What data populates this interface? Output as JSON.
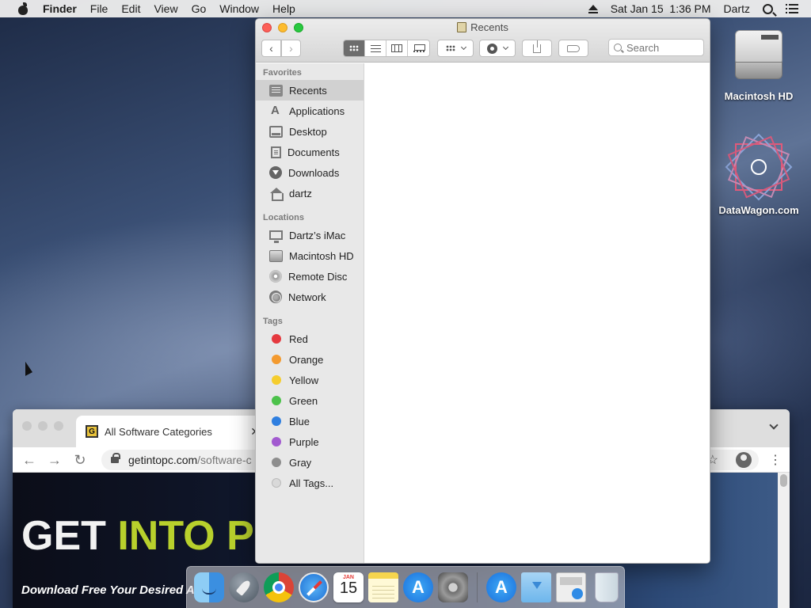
{
  "menubar": {
    "app_name": "Finder",
    "items": [
      "File",
      "Edit",
      "View",
      "Go",
      "Window",
      "Help"
    ],
    "datetime": "Sat Jan 15  1:36 PM",
    "user": "Dartz"
  },
  "desktop": {
    "icons": [
      {
        "label": "Macintosh HD",
        "icon": "hard-drive-icon"
      },
      {
        "label": "DataWagon.com",
        "icon": "star-pattern-icon"
      }
    ]
  },
  "finder": {
    "title": "Recents",
    "search_placeholder": "Search",
    "view_mode": "icon",
    "sidebar": {
      "favorites_header": "Favorites",
      "favorites": [
        {
          "label": "Recents",
          "icon": "recents-icon",
          "selected": true
        },
        {
          "label": "Applications",
          "icon": "applications-icon"
        },
        {
          "label": "Desktop",
          "icon": "desktop-icon"
        },
        {
          "label": "Documents",
          "icon": "documents-icon"
        },
        {
          "label": "Downloads",
          "icon": "downloads-icon"
        },
        {
          "label": "dartz",
          "icon": "home-icon"
        }
      ],
      "locations_header": "Locations",
      "locations": [
        {
          "label": "Dartz’s iMac",
          "icon": "imac-icon"
        },
        {
          "label": "Macintosh HD",
          "icon": "hard-drive-icon"
        },
        {
          "label": "Remote Disc",
          "icon": "disc-icon"
        },
        {
          "label": "Network",
          "icon": "network-icon"
        }
      ],
      "tags_header": "Tags",
      "tags": [
        {
          "label": "Red",
          "color": "#e5393f"
        },
        {
          "label": "Orange",
          "color": "#f39a2f"
        },
        {
          "label": "Yellow",
          "color": "#f5cd2e"
        },
        {
          "label": "Green",
          "color": "#4cc24b"
        },
        {
          "label": "Blue",
          "color": "#2f7fe0"
        },
        {
          "label": "Purple",
          "color": "#a25ad0"
        },
        {
          "label": "Gray",
          "color": "#8e8e8e"
        },
        {
          "label": "All Tags...",
          "color": "#d9d9d9"
        }
      ]
    }
  },
  "browser": {
    "tab_title": "All Software Categories",
    "tab_close": "✕",
    "url_host": "getintopc.com",
    "url_path": "/software-c",
    "favicon_letter": "G",
    "hero_text_1": "GET ",
    "hero_text_2": "INTO P",
    "tagline": "Download Free Your Desired A"
  },
  "dock": {
    "calendar_month": "JAN",
    "calendar_day": "15"
  }
}
